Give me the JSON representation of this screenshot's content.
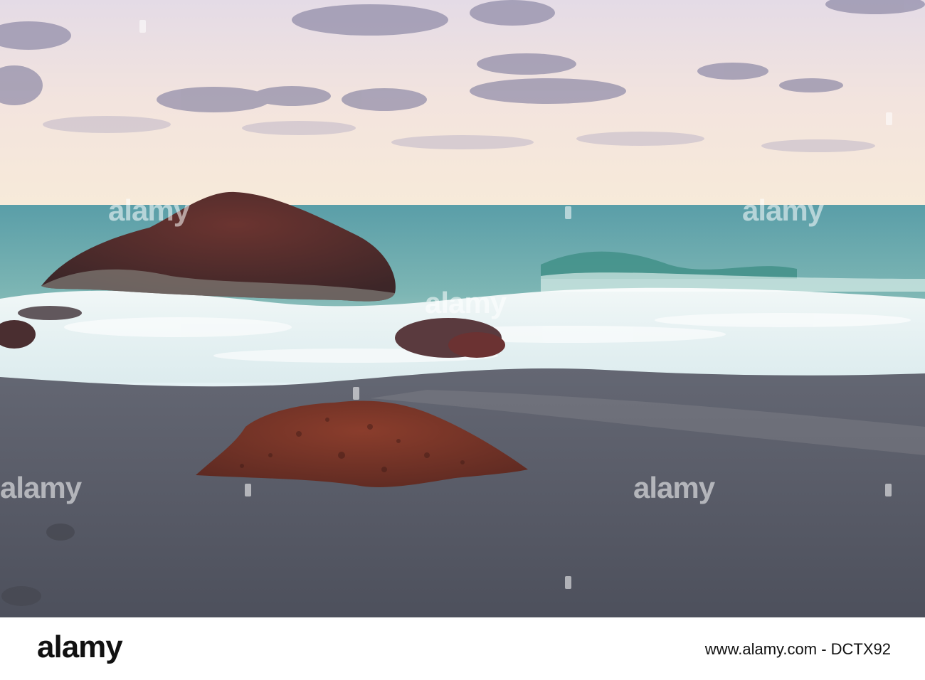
{
  "image": {
    "description_tags": [
      "beach",
      "rock",
      "sea",
      "waves",
      "dusk"
    ],
    "colors": {
      "sky_top": "#e9dde4",
      "sky_horizon": "#f6e9d8",
      "sea": "#5fa7a6",
      "foam": "#e8f3f5",
      "sand": "#5b5f6b",
      "rock_red": "#7a3526",
      "rock_dark": "#4a2a28"
    }
  },
  "watermark": {
    "text": "alamy"
  },
  "footer": {
    "logo": "alamy",
    "image_id": "www.alamy.com - DCTX92"
  }
}
